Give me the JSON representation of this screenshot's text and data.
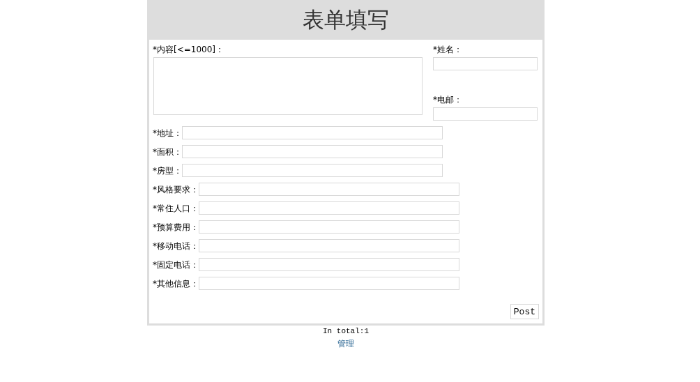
{
  "title": "表单填写",
  "content_field": {
    "label": "*内容[<=1000]："
  },
  "side_fields": [
    {
      "label": "*姓名："
    },
    {
      "label": "*电邮："
    }
  ],
  "fields": [
    {
      "label": "*地址："
    },
    {
      "label": "*面积："
    },
    {
      "label": "*房型："
    },
    {
      "label": "*风格要求："
    },
    {
      "label": "*常住人口："
    },
    {
      "label": "*预算费用："
    },
    {
      "label": "*移动电话："
    },
    {
      "label": "*固定电话："
    },
    {
      "label": "*其他信息："
    }
  ],
  "submit": "Post",
  "total": "In total:1",
  "manage_link": "管理"
}
